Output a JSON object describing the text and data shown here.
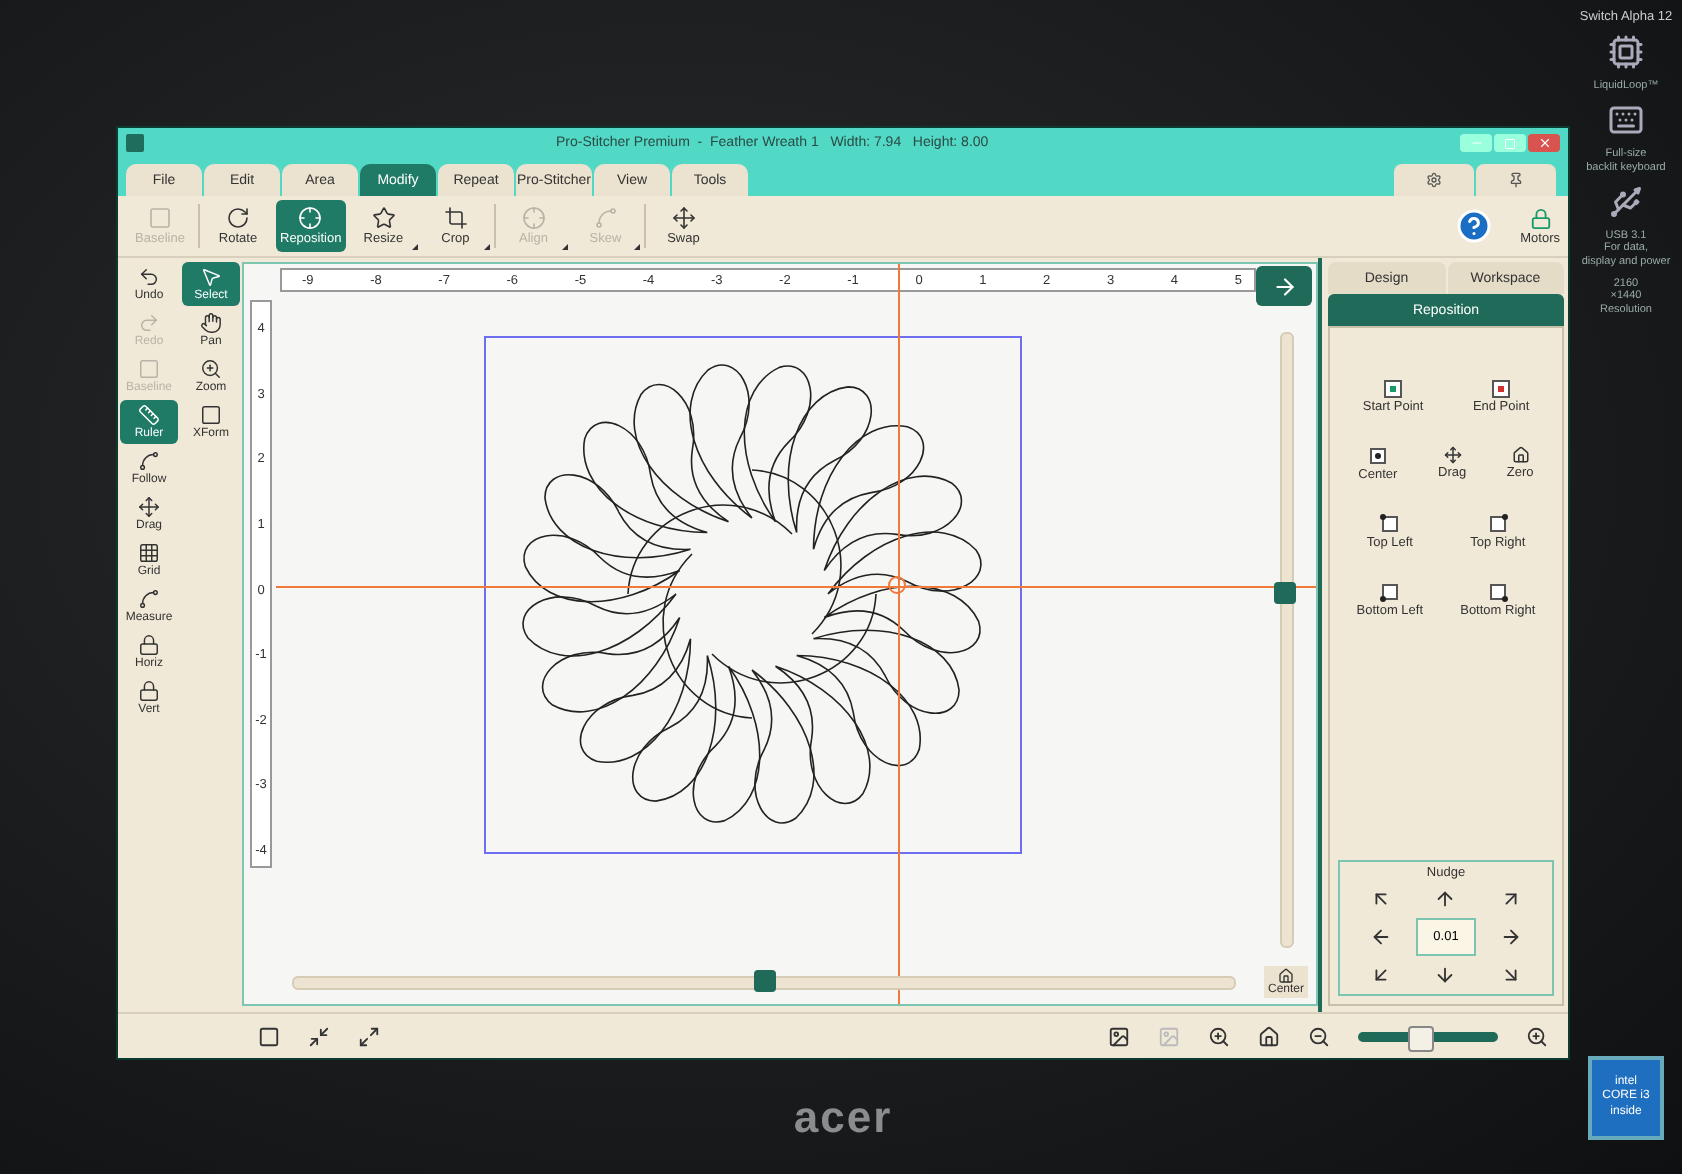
{
  "window": {
    "title": "Pro-Stitcher Premium  -  Feather Wreath 1   Width: 7.94   Height: 8.00"
  },
  "menu_tabs": [
    {
      "label": "File",
      "selected": false
    },
    {
      "label": "Edit",
      "selected": false
    },
    {
      "label": "Area",
      "selected": false
    },
    {
      "label": "Modify",
      "selected": true
    },
    {
      "label": "Repeat",
      "selected": false
    },
    {
      "label": "Pro-Stitcher",
      "selected": false
    },
    {
      "label": "View",
      "selected": false
    },
    {
      "label": "Tools",
      "selected": false
    }
  ],
  "toolbar": {
    "tools": [
      {
        "label": "Baseline",
        "kind": "baseline",
        "selected": false,
        "disabled": true,
        "dropdown": false
      },
      {
        "label": "Rotate",
        "kind": "rotate",
        "selected": false,
        "disabled": false,
        "dropdown": false
      },
      {
        "label": "Reposition",
        "kind": "reposition",
        "selected": true,
        "disabled": false,
        "dropdown": false
      },
      {
        "label": "Resize",
        "kind": "resize",
        "selected": false,
        "disabled": false,
        "dropdown": true
      },
      {
        "label": "Crop",
        "kind": "crop",
        "selected": false,
        "disabled": false,
        "dropdown": true
      },
      {
        "label": "Align",
        "kind": "align",
        "selected": false,
        "disabled": true,
        "dropdown": true
      },
      {
        "label": "Skew",
        "kind": "skew",
        "selected": false,
        "disabled": true,
        "dropdown": true
      },
      {
        "label": "Swap",
        "kind": "swap",
        "selected": false,
        "disabled": false,
        "dropdown": false
      }
    ],
    "motors": {
      "label": "Motors"
    }
  },
  "left_tools": {
    "column_1": [
      {
        "label": "Undo",
        "kind": "undo",
        "selected": false,
        "disabled": false
      },
      {
        "label": "Redo",
        "kind": "redo",
        "selected": false,
        "disabled": true
      },
      {
        "label": "Baseline",
        "kind": "baseline",
        "selected": false,
        "disabled": true
      },
      {
        "label": "Ruler",
        "kind": "ruler",
        "selected": true,
        "disabled": false
      },
      {
        "label": "Follow",
        "kind": "follow",
        "selected": false,
        "disabled": false
      },
      {
        "label": "Drag",
        "kind": "drag",
        "selected": false,
        "disabled": false
      },
      {
        "label": "Grid",
        "kind": "grid",
        "selected": false,
        "disabled": false
      },
      {
        "label": "Measure",
        "kind": "measure",
        "selected": false,
        "disabled": false
      },
      {
        "label": "Horiz",
        "kind": "lock",
        "selected": false,
        "disabled": false
      },
      {
        "label": "Vert",
        "kind": "lock",
        "selected": false,
        "disabled": false
      }
    ],
    "column_2": [
      {
        "label": "Select",
        "kind": "select",
        "selected": true,
        "disabled": false
      },
      {
        "label": "Pan",
        "kind": "pan",
        "selected": false,
        "disabled": false
      },
      {
        "label": "Zoom",
        "kind": "zoom",
        "selected": false,
        "disabled": false
      },
      {
        "label": "XForm",
        "kind": "xform",
        "selected": false,
        "disabled": false
      }
    ]
  },
  "canvas": {
    "x_ruler": [
      "-9",
      "-8",
      "-7",
      "-6",
      "-5",
      "-4",
      "-3",
      "-2",
      "-1",
      "0",
      "1",
      "2",
      "3",
      "4",
      "5"
    ],
    "y_ruler": [
      "4",
      "3",
      "2",
      "1",
      "0",
      "-1",
      "-2",
      "-3",
      "-4"
    ],
    "vertical_slider": {
      "level": 0.58
    },
    "horizontal_slider": {
      "level": 0.5
    },
    "center_button": {
      "label": "Center"
    }
  },
  "right_panel": {
    "tabs": [
      {
        "label": "Design",
        "selected": false
      },
      {
        "label": "Workspace",
        "selected": false
      }
    ],
    "header": "Reposition",
    "rows": [
      [
        {
          "label": "Start Point",
          "kind": "start"
        },
        {
          "label": "End Point",
          "kind": "end"
        }
      ],
      [
        {
          "label": "Center",
          "kind": "center"
        },
        {
          "label": "Drag",
          "kind": "drag"
        },
        {
          "label": "Zero",
          "kind": "zero"
        }
      ],
      [
        {
          "label": "Top Left",
          "kind": "top_left"
        },
        {
          "label": "Top Right",
          "kind": "top_right"
        }
      ],
      [
        {
          "label": "Bottom Left",
          "kind": "bottom_left"
        },
        {
          "label": "Bottom Right",
          "kind": "bottom_right"
        }
      ]
    ],
    "nudge": {
      "title": "Nudge",
      "value": "0.01"
    }
  },
  "status_bar": {
    "zoom_slider": {
      "level": 0.43
    }
  },
  "device": {
    "brand": "acer",
    "stickers": [
      {
        "kind": "title",
        "lines": [
          "Switch Alpha 12"
        ]
      },
      {
        "kind": "cpu",
        "lines": [
          "LiquidLoop™"
        ]
      },
      {
        "kind": "keyboard",
        "lines": [
          "Full-size",
          "backlit keyboard"
        ]
      },
      {
        "kind": "usb",
        "lines": [
          "USB 3.1",
          "For data,",
          "display and power"
        ]
      },
      {
        "kind": "resolution",
        "lines": [
          "2160",
          "×1440",
          "Resolution"
        ]
      }
    ],
    "badge": {
      "lines": [
        "intel",
        "CORE i3",
        "inside"
      ]
    }
  }
}
